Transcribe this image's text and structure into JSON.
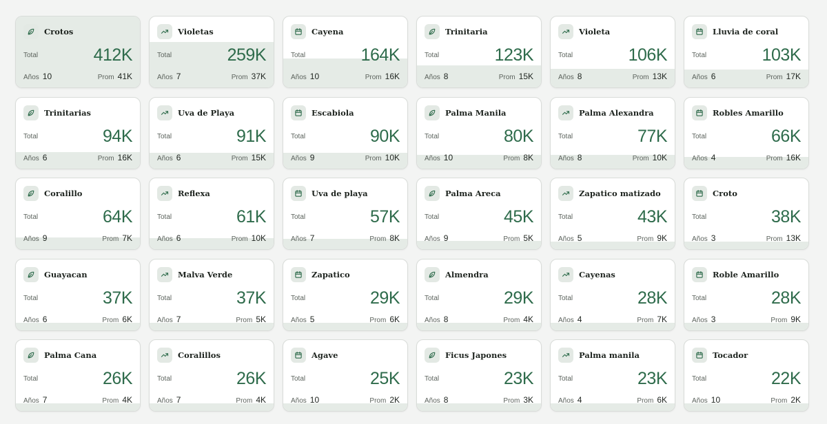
{
  "labels": {
    "total": "Total",
    "years": "Años",
    "avg": "Prom"
  },
  "colors": {
    "accent": "#2e6b4b",
    "fill": "#e5ebe6",
    "card_border": "#d9dcd9"
  },
  "cards": [
    {
      "name": "Crotos",
      "icon": "leaf-icon",
      "total": "412K",
      "years": "10",
      "avg": "41K",
      "share": 1.0
    },
    {
      "name": "Violetas",
      "icon": "trend-icon",
      "total": "259K",
      "years": "7",
      "avg": "37K",
      "share": 0.63
    },
    {
      "name": "Cayena",
      "icon": "calendar-icon",
      "total": "164K",
      "years": "10",
      "avg": "16K",
      "share": 0.4
    },
    {
      "name": "Trinitaria",
      "icon": "leaf-icon",
      "total": "123K",
      "years": "8",
      "avg": "15K",
      "share": 0.3
    },
    {
      "name": "Violeta",
      "icon": "trend-icon",
      "total": "106K",
      "years": "8",
      "avg": "13K",
      "share": 0.26
    },
    {
      "name": "Lluvia de coral",
      "icon": "calendar-icon",
      "total": "103K",
      "years": "6",
      "avg": "17K",
      "share": 0.25
    },
    {
      "name": "Trinitarias",
      "icon": "leaf-icon",
      "total": "94K",
      "years": "6",
      "avg": "16K",
      "share": 0.23
    },
    {
      "name": "Uva de Playa",
      "icon": "trend-icon",
      "total": "91K",
      "years": "6",
      "avg": "15K",
      "share": 0.22
    },
    {
      "name": "Escabiola",
      "icon": "calendar-icon",
      "total": "90K",
      "years": "9",
      "avg": "10K",
      "share": 0.22
    },
    {
      "name": "Palma Manila",
      "icon": "leaf-icon",
      "total": "80K",
      "years": "10",
      "avg": "8K",
      "share": 0.19
    },
    {
      "name": "Palma Alexandra",
      "icon": "trend-icon",
      "total": "77K",
      "years": "8",
      "avg": "10K",
      "share": 0.19
    },
    {
      "name": "Robles Amarillo",
      "icon": "calendar-icon",
      "total": "66K",
      "years": "4",
      "avg": "16K",
      "share": 0.16
    },
    {
      "name": "Coralillo",
      "icon": "leaf-icon",
      "total": "64K",
      "years": "9",
      "avg": "7K",
      "share": 0.16
    },
    {
      "name": "Reflexa",
      "icon": "trend-icon",
      "total": "61K",
      "years": "6",
      "avg": "10K",
      "share": 0.15
    },
    {
      "name": "Uva de playa",
      "icon": "calendar-icon",
      "total": "57K",
      "years": "7",
      "avg": "8K",
      "share": 0.14
    },
    {
      "name": "Palma Areca",
      "icon": "leaf-icon",
      "total": "45K",
      "years": "9",
      "avg": "5K",
      "share": 0.11
    },
    {
      "name": "Zapatico matizado",
      "icon": "trend-icon",
      "total": "43K",
      "years": "5",
      "avg": "9K",
      "share": 0.1
    },
    {
      "name": "Croto",
      "icon": "calendar-icon",
      "total": "38K",
      "years": "3",
      "avg": "13K",
      "share": 0.09
    },
    {
      "name": "Guayacan",
      "icon": "leaf-icon",
      "total": "37K",
      "years": "6",
      "avg": "6K",
      "share": 0.09
    },
    {
      "name": "Malva Verde",
      "icon": "trend-icon",
      "total": "37K",
      "years": "7",
      "avg": "5K",
      "share": 0.09
    },
    {
      "name": "Zapatico",
      "icon": "calendar-icon",
      "total": "29K",
      "years": "5",
      "avg": "6K",
      "share": 0.07
    },
    {
      "name": "Almendra",
      "icon": "leaf-icon",
      "total": "29K",
      "years": "8",
      "avg": "4K",
      "share": 0.07
    },
    {
      "name": "Cayenas",
      "icon": "trend-icon",
      "total": "28K",
      "years": "4",
      "avg": "7K",
      "share": 0.07
    },
    {
      "name": "Roble Amarillo",
      "icon": "calendar-icon",
      "total": "28K",
      "years": "3",
      "avg": "9K",
      "share": 0.07
    },
    {
      "name": "Palma Cana",
      "icon": "leaf-icon",
      "total": "26K",
      "years": "7",
      "avg": "4K",
      "share": 0.06
    },
    {
      "name": "Coralillos",
      "icon": "trend-icon",
      "total": "26K",
      "years": "7",
      "avg": "4K",
      "share": 0.06
    },
    {
      "name": "Agave",
      "icon": "calendar-icon",
      "total": "25K",
      "years": "10",
      "avg": "2K",
      "share": 0.06
    },
    {
      "name": "Ficus Japones",
      "icon": "leaf-icon",
      "total": "23K",
      "years": "8",
      "avg": "3K",
      "share": 0.06
    },
    {
      "name": "Palma manila",
      "icon": "trend-icon",
      "total": "23K",
      "years": "4",
      "avg": "6K",
      "share": 0.06
    },
    {
      "name": "Tocador",
      "icon": "calendar-icon",
      "total": "22K",
      "years": "10",
      "avg": "2K",
      "share": 0.05
    }
  ]
}
